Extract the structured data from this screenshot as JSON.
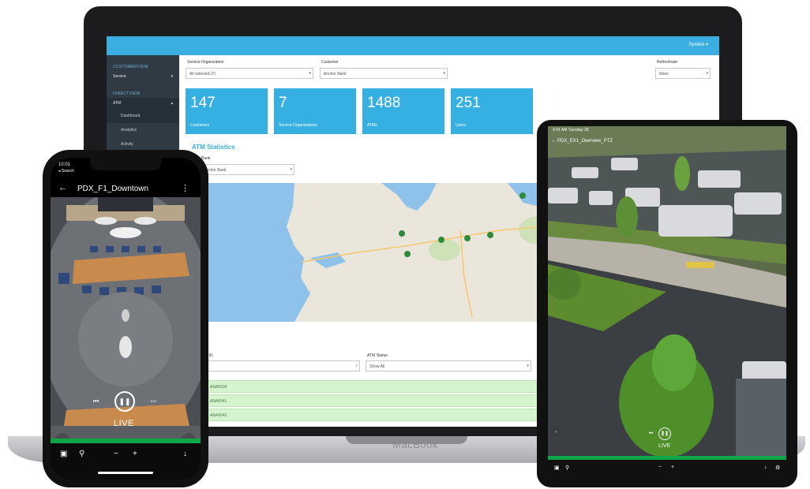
{
  "laptop": {
    "brand": "MacBook",
    "dashboard": {
      "user_menu": "System ▾",
      "sidebar": {
        "section1": "CUSTOMERVIEW",
        "service": "Service",
        "section2": "DIRECTVIEW",
        "atm": "ATM",
        "sub_items": [
          "Dashboard",
          "Analytics",
          "Activity"
        ]
      },
      "filters": {
        "service_org_label": "Service Organization",
        "service_org_value": "All selected (7)",
        "customer_label": "Customer",
        "customer_value": "Anchor Bank",
        "refresh_label": "Refreshrate",
        "refresh_value": "None"
      },
      "tiles": [
        {
          "value": "147",
          "label": "Customers"
        },
        {
          "value": "7",
          "label": "Service Organisations"
        },
        {
          "value": "1488",
          "label": "ATMs"
        },
        {
          "value": "251",
          "label": "Users"
        }
      ],
      "atm_section": {
        "title": "ATM Statistics",
        "bank_label": "Bank",
        "bank_value": "Anchor Bank"
      },
      "lower": {
        "atm_id_label": "ATM ID",
        "atm_status_label": "ATM Status",
        "atm_status_value": "Show All",
        "rows": [
          "ANA0039",
          "ANA0041",
          "ANA0042"
        ]
      }
    }
  },
  "tablet": {
    "status_left": "9:41 AM  Tuesday 28",
    "title": "PDX_EX1_Overview_PTZ",
    "live": "LIVE"
  },
  "phone": {
    "time": "10:01",
    "back_app": "◂ Search",
    "title": "PDX_F1_Downtown",
    "live": "LIVE"
  },
  "colors": {
    "accent": "#36b0e2",
    "sidebar": "#2f3a44",
    "timeline": "#0fa64a",
    "row_green": "#d6f3d0"
  }
}
